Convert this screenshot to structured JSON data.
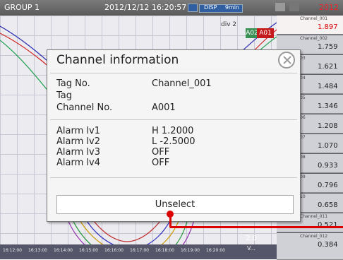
{
  "topbar": {
    "group": "GROUP 1",
    "datetime": "2012/12/12 16:20:57",
    "disp": "DISP",
    "interval": "9min",
    "right_fragment": "2012"
  },
  "trend": {
    "time_labels": [
      "16:12:00",
      "16:13:00",
      "16:14:00",
      "16:15:00",
      "16:16:00",
      "16:17:00",
      "16:18:00",
      "16:19:00",
      "16:20:00"
    ],
    "legend_fragment": "div 2",
    "alarm_tags": [
      "A01",
      "A02"
    ],
    "scale_value": "2.0",
    "v_prefix": "V..."
  },
  "channels": [
    {
      "name": "Channel_001",
      "value": "1.897"
    },
    {
      "name": "Channel_002",
      "value": "1.759"
    },
    {
      "name": "03",
      "value": "1.621"
    },
    {
      "name": "04",
      "value": "1.484"
    },
    {
      "name": "05",
      "value": "1.346"
    },
    {
      "name": "06",
      "value": "1.208"
    },
    {
      "name": "07",
      "value": "1.070"
    },
    {
      "name": "08",
      "value": "0.933"
    },
    {
      "name": "09",
      "value": "0.796"
    },
    {
      "name": "10",
      "value": "0.658"
    },
    {
      "name": "Channel_011",
      "value": "0.521"
    },
    {
      "name": "Channel_012",
      "value": "0.384"
    }
  ],
  "dialog": {
    "title": "Channel information",
    "tag_no_label": "Tag No.",
    "tag_no_value": "Channel_001",
    "tag_label": "Tag",
    "channel_no_label": "Channel No.",
    "channel_no_value": "A001",
    "alarms": [
      {
        "label": "Alarm lv1",
        "value": "H 1.2000"
      },
      {
        "label": "Alarm lv2",
        "value": "L -2.5000"
      },
      {
        "label": "Alarm lv3",
        "value": "OFF"
      },
      {
        "label": "Alarm lv4",
        "value": "OFF"
      }
    ],
    "unselect_label": "Unselect"
  },
  "colors": {
    "accent_red": "#dd0000",
    "alarm_green": "#3a8f55",
    "topbar": "#666666"
  }
}
